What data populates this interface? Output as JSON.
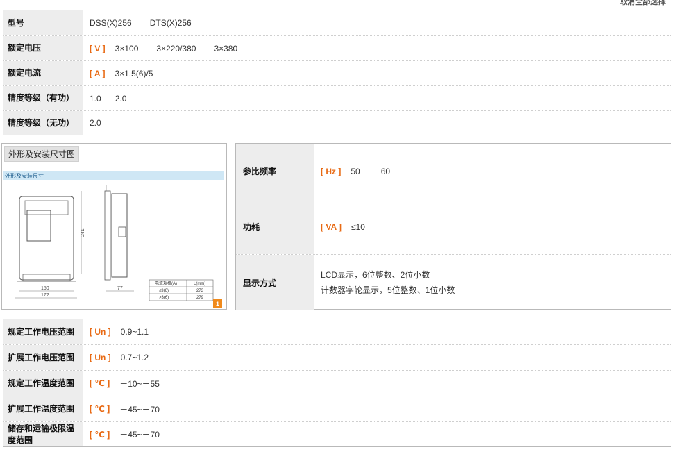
{
  "top_link": "取消全部选择",
  "spec_top": [
    {
      "label": "型号",
      "unit": "",
      "values": [
        "DSS(X)256",
        "DTS(X)256"
      ]
    },
    {
      "label": "额定电压",
      "unit": "[ V ]",
      "values": [
        "3×100",
        "3×220/380",
        "3×380"
      ]
    },
    {
      "label": "额定电流",
      "unit": "[ A ]",
      "values": [
        "3×1.5(6)/5"
      ]
    },
    {
      "label": "精度等级（有功）",
      "unit": "",
      "values": [
        "1.0",
        "2.0"
      ]
    },
    {
      "label": "精度等级（无功）",
      "unit": "",
      "values": [
        "2.0"
      ]
    }
  ],
  "diagram": {
    "panel_title": "外形及安装尺寸图",
    "header": "外形及安装尺寸",
    "dims": {
      "width_inner": "150",
      "width_outer": "172",
      "height": "241",
      "depth": "77"
    },
    "table_head": [
      "电流规格(A)",
      "L(mm)"
    ],
    "table_rows": [
      [
        "≤3(6)",
        "273"
      ],
      [
        ">3(6)",
        "279"
      ]
    ],
    "badge": "1"
  },
  "spec_mid": [
    {
      "label": "参比频率",
      "unit": "[ Hz ]",
      "values": [
        "50",
        "60"
      ]
    },
    {
      "label": "功耗",
      "unit": "[ VA ]",
      "values": [
        "≤10"
      ]
    },
    {
      "label": "显示方式",
      "unit": "",
      "lines": [
        "LCD显示，6位整数、2位小数",
        "计数器字轮显示，5位整数、1位小数"
      ]
    }
  ],
  "spec_bottom": [
    {
      "label": "规定工作电压范围",
      "unit": "[ Un ]",
      "value": "0.9~1.1"
    },
    {
      "label": "扩展工作电压范围",
      "unit": "[ Un ]",
      "value": "0.7~1.2"
    },
    {
      "label": "规定工作温度范围",
      "unit": "[ ℃ ]",
      "value": "－10~＋55"
    },
    {
      "label": "扩展工作温度范围",
      "unit": "[ ℃ ]",
      "value": "－45~＋70"
    },
    {
      "label": "储存和运输极限温度范围",
      "unit": "[ ℃ ]",
      "value": "－45~＋70"
    }
  ]
}
